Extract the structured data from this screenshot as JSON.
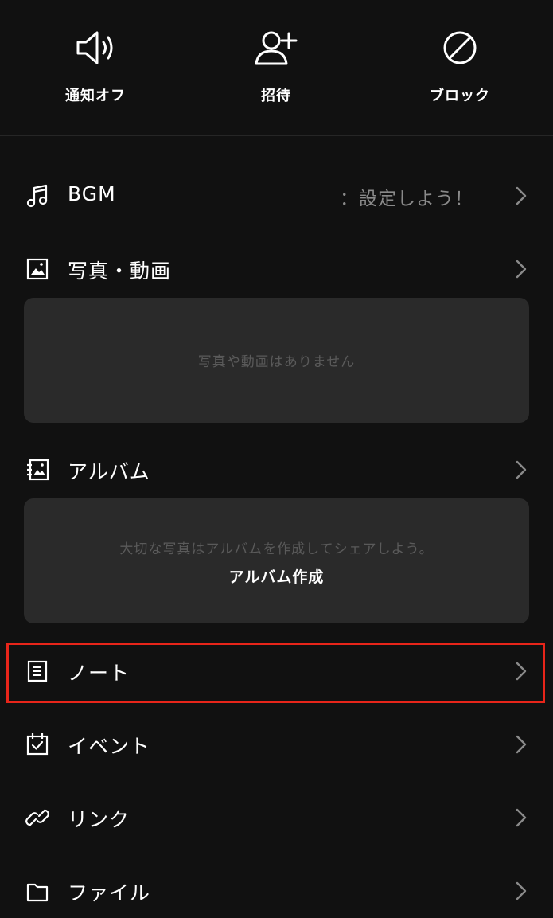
{
  "top_actions": [
    {
      "icon": "speaker-icon",
      "label": "通知オフ"
    },
    {
      "icon": "add-user-icon",
      "label": "招待"
    },
    {
      "icon": "block-icon",
      "label": "ブロック"
    }
  ],
  "menu": {
    "bgm": {
      "label": "BGM",
      "value": "：設定しよう！",
      "icon": "music-note-icon"
    },
    "photos": {
      "label": "写真・動画",
      "icon": "image-icon",
      "empty_text": "写真や動画はありません"
    },
    "album": {
      "label": "アルバム",
      "icon": "album-icon",
      "empty_text": "大切な写真はアルバムを作成してシェアしよう。",
      "create_label": "アルバム作成"
    },
    "note": {
      "label": "ノート",
      "icon": "note-icon",
      "highlight_color": "#e8251a"
    },
    "event": {
      "label": "イベント",
      "icon": "calendar-check-icon"
    },
    "link": {
      "label": "リンク",
      "icon": "link-icon"
    },
    "file": {
      "label": "ファイル",
      "icon": "folder-icon"
    }
  },
  "colors": {
    "background": "#111111",
    "panel": "#2a2a2a",
    "highlight": "#e8251a",
    "muted_text": "#8a8a8a"
  }
}
